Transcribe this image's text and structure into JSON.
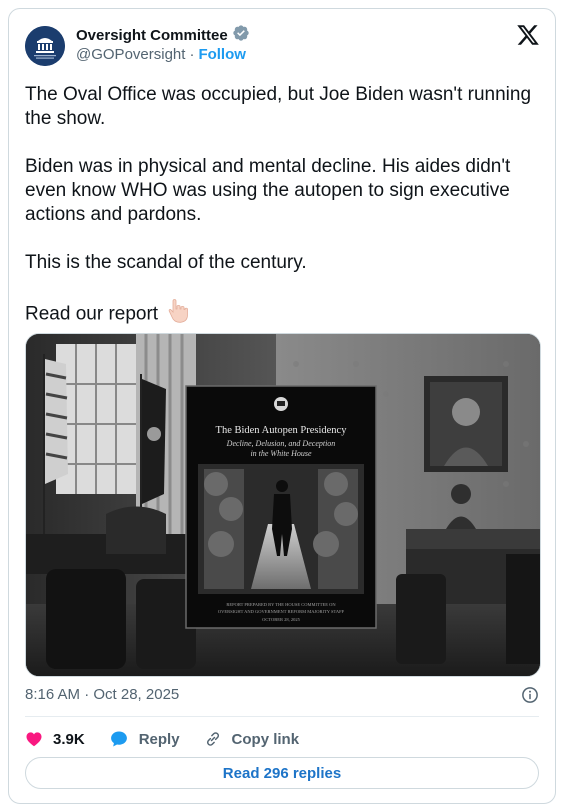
{
  "author": {
    "display_name": "Oversight Committee",
    "handle": "@GOPoversight",
    "separator": "·",
    "follow_label": "Follow",
    "verified_color": "#829aab"
  },
  "tweet": {
    "paragraphs": [
      "The Oval Office was occupied, but Joe Biden wasn't running the show.",
      "Biden was in physical and mental decline. His aides didn't even know WHO was using the autopen to sign executive actions and pardons.",
      "This is the scandal of the century."
    ],
    "last_line": "Read our report",
    "emoji": "pointing-down-hand"
  },
  "media": {
    "report_title": "The Biden Autopen Presidency",
    "report_subtitle_1": "Decline, Delusion, and Deception",
    "report_subtitle_2": "in the White House",
    "report_footer_1": "REPORT PREPARED BY THE HOUSE COMMITTEE ON",
    "report_footer_2": "OVERSIGHT AND GOVERNMENT REFORM MAJORITY STAFF",
    "report_date": "OCTOBER 28, 2025"
  },
  "meta": {
    "timestamp": "8:16 AM · Oct 28, 2025"
  },
  "actions": {
    "likes": "3.9K",
    "reply_label": "Reply",
    "copy_label": "Copy link",
    "read_replies_label": "Read 296 replies"
  },
  "colors": {
    "like": "#f91880",
    "reply": "#1d9bf0",
    "link": "#1d74c8",
    "muted": "#536471"
  }
}
